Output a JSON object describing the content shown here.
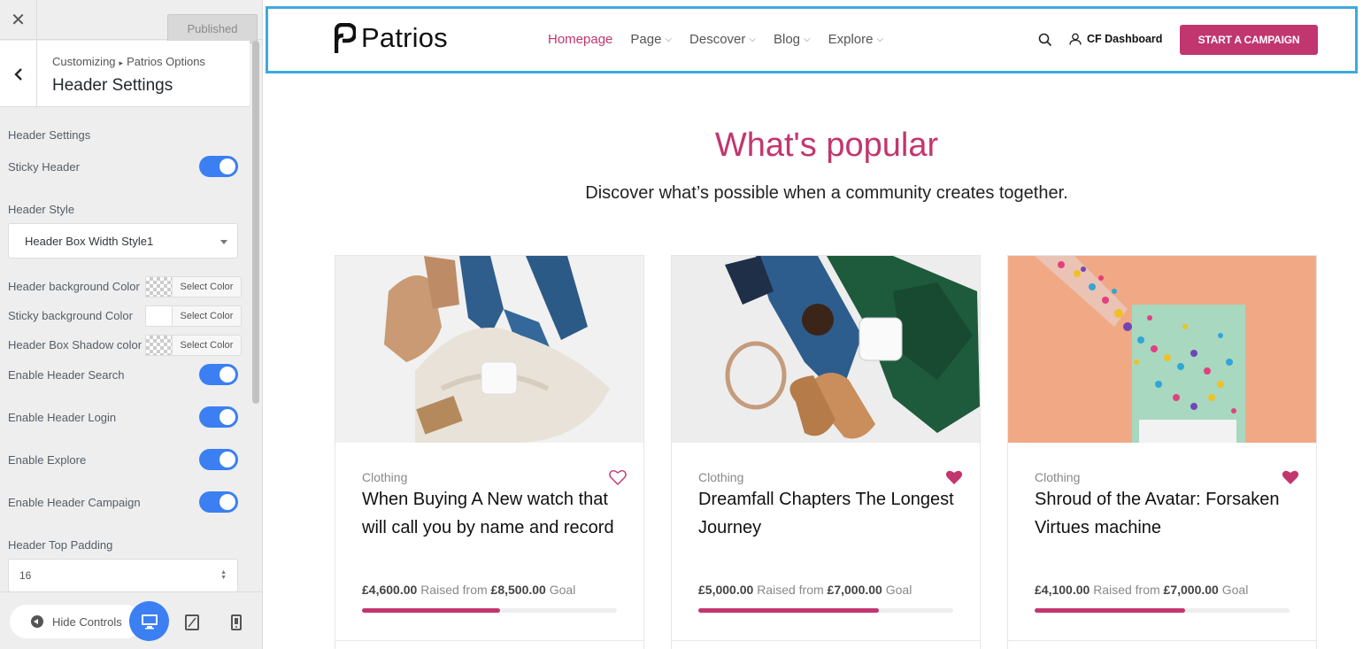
{
  "customizer": {
    "close_label": "✕",
    "published_label": "Published",
    "breadcrumb_root": "Customizing",
    "breadcrumb_parent": "Patrios Options",
    "section_title": "Header Settings",
    "controls": {
      "group_heading": "Header Settings",
      "sticky_header": {
        "label": "Sticky Header",
        "enabled": true
      },
      "header_style": {
        "label": "Header Style",
        "value": "Header Box Width Style1"
      },
      "header_bg_color": {
        "label": "Header background Color",
        "button": "Select Color"
      },
      "sticky_bg_color": {
        "label": "Sticky background Color",
        "button": "Select Color"
      },
      "box_shadow_color": {
        "label": "Header Box Shadow color",
        "button": "Select Color"
      },
      "enable_search": {
        "label": "Enable Header Search",
        "enabled": true
      },
      "enable_login": {
        "label": "Enable Header Login",
        "enabled": true
      },
      "enable_explore": {
        "label": "Enable Explore",
        "enabled": true
      },
      "enable_campaign": {
        "label": "Enable Header Campaign",
        "enabled": true
      },
      "top_padding": {
        "label": "Header Top Padding",
        "value": "16"
      }
    },
    "footer": {
      "hide_controls": "Hide Controls"
    }
  },
  "site": {
    "logo_text": "Patrios",
    "nav": [
      {
        "label": "Homepage",
        "active": true,
        "dropdown": false
      },
      {
        "label": "Page",
        "active": false,
        "dropdown": true
      },
      {
        "label": "Descover",
        "active": false,
        "dropdown": true
      },
      {
        "label": "Blog",
        "active": false,
        "dropdown": true
      },
      {
        "label": "Explore",
        "active": false,
        "dropdown": true
      }
    ],
    "dashboard_label": "CF Dashboard",
    "cta_label": "START A CAMPAIGN",
    "accent_color": "#c2366f",
    "popular_title": "What's popular",
    "popular_subtitle": "Discover what’s possible when a community creates together.",
    "raised_word": "Raised from",
    "goal_word": "Goal",
    "cards": [
      {
        "category": "Clothing",
        "title": "When Buying A New watch that will call you by name and record",
        "raised": "£4,600.00",
        "goal": "£8,500.00",
        "progress": 0.54,
        "favorited": false
      },
      {
        "category": "Clothing",
        "title": "Dreamfall Chapters The Longest Journey",
        "raised": "£5,000.00",
        "goal": "£7,000.00",
        "progress": 0.71,
        "favorited": true
      },
      {
        "category": "Clothing",
        "title": "Shroud of the Avatar: Forsaken Virtues machine",
        "raised": "£4,100.00",
        "goal": "£7,000.00",
        "progress": 0.59,
        "favorited": true
      }
    ]
  }
}
